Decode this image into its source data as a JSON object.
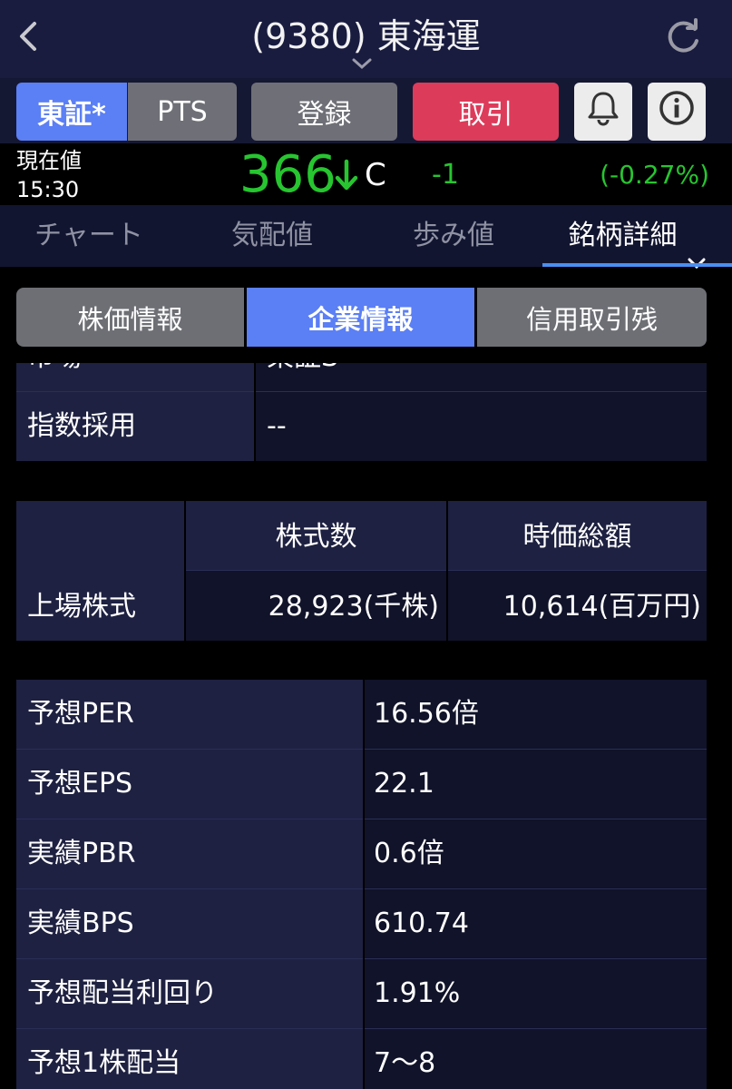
{
  "header": {
    "title": "(9380) 東海運"
  },
  "actions": {
    "tse": "東証*",
    "pts": "PTS",
    "register": "登録",
    "trade": "取引"
  },
  "price": {
    "label_line1": "現在値",
    "label_line2": "15:30",
    "value": "366",
    "flag": "C",
    "change": "-1",
    "change_pct": "(-0.27%)",
    "color_down": "#27c530"
  },
  "tabs": [
    "チャート",
    "気配値",
    "歩み値",
    "銘柄詳細"
  ],
  "segments": [
    "株価情報",
    "企業情報",
    "信用取引残"
  ],
  "table1": {
    "rows": [
      {
        "label": "市場",
        "value": "東証S"
      },
      {
        "label": "指数採用",
        "value": "--"
      }
    ]
  },
  "table2": {
    "col1": "株式数",
    "col2": "時価総額",
    "row_label": "上場株式",
    "shares": "28,923(千株)",
    "market_cap": "10,614(百万円)"
  },
  "table3": {
    "rows": [
      {
        "label": "予想PER",
        "value": "16.56倍"
      },
      {
        "label": "予想EPS",
        "value": "22.1"
      },
      {
        "label": "実績PBR",
        "value": "0.6倍"
      },
      {
        "label": "実績BPS",
        "value": "610.74"
      },
      {
        "label": "予想配当利回り",
        "value": "1.91%"
      },
      {
        "label": "予想1株配当",
        "value": "7〜8"
      }
    ]
  },
  "colors": {
    "accent": "#5b7ff4",
    "trade": "#dd3b5a",
    "header_bg": "#191c3f"
  }
}
